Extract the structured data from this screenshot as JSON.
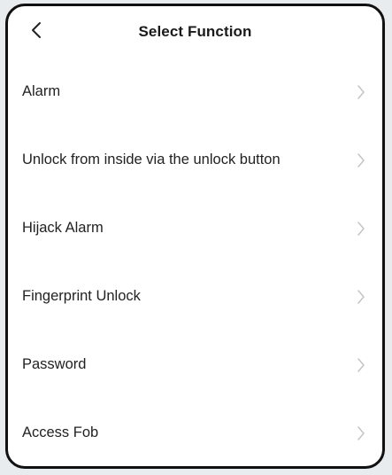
{
  "header": {
    "back_icon": "chevron-left-icon",
    "title": "Select Function"
  },
  "functions": {
    "items": [
      {
        "label": "Alarm",
        "icon": "chevron-right-icon"
      },
      {
        "label": "Unlock from inside via the unlock button",
        "icon": "chevron-right-icon"
      },
      {
        "label": "Hijack Alarm",
        "icon": "chevron-right-icon"
      },
      {
        "label": "Fingerprint Unlock",
        "icon": "chevron-right-icon"
      },
      {
        "label": "Password",
        "icon": "chevron-right-icon"
      },
      {
        "label": "Access Fob",
        "icon": "chevron-right-icon"
      }
    ]
  },
  "colors": {
    "frame": "#111111",
    "background": "#ffffff",
    "text": "#222222",
    "chevron": "#c4c4c4"
  }
}
